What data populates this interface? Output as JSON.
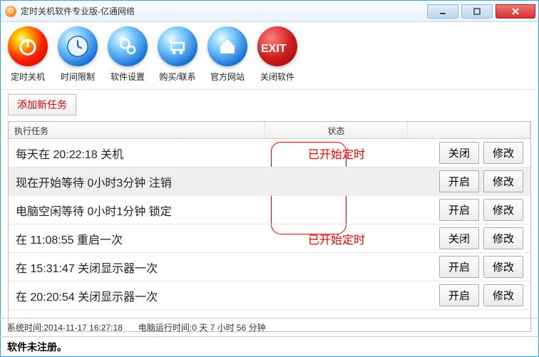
{
  "window": {
    "title": "定时关机软件专业版-亿通网络"
  },
  "toolbar": [
    {
      "id": "shutdown",
      "label": "定时关机",
      "color": "red",
      "glyph": "power"
    },
    {
      "id": "timelimit",
      "label": "时间限制",
      "color": "blue",
      "glyph": "clock"
    },
    {
      "id": "settings",
      "label": "软件设置",
      "color": "blue",
      "glyph": "gears"
    },
    {
      "id": "buy",
      "label": "购买/联系",
      "color": "blue",
      "glyph": "cart"
    },
    {
      "id": "website",
      "label": "官方网站",
      "color": "blue",
      "glyph": "home"
    },
    {
      "id": "exit",
      "label": "关闭软件",
      "color": "darkred",
      "glyph": "exit"
    }
  ],
  "addTaskLabel": "添加新任务",
  "columns": {
    "task": "执行任务",
    "status": "状态"
  },
  "btn": {
    "close": "关闭",
    "open": "开启",
    "edit": "修改"
  },
  "statusStarted": "已开始定时",
  "tasks": [
    {
      "text": "每天在 20:22:18 关机",
      "status": "started",
      "btn1": "close"
    },
    {
      "text": "现在开始等待 0小时3分钟 注销",
      "status": "",
      "btn1": "open",
      "selected": true
    },
    {
      "text": "电脑空闲等待 0小时1分钟 锁定",
      "status": "",
      "btn1": "open"
    },
    {
      "text": "在 11:08:55 重启一次",
      "status": "started",
      "btn1": "close"
    },
    {
      "text": "在 15:31:47 关闭显示器一次",
      "status": "",
      "btn1": "open"
    },
    {
      "text": "在 20:20:54 关闭显示器一次",
      "status": "",
      "btn1": "open"
    }
  ],
  "footer": {
    "systime_label": "系统时间:",
    "systime": "2014-11-17 16:27:18",
    "uptime_label": "电脑运行时间:",
    "uptime": "0 天 7 小时 56 分钟",
    "register": "软件未注册。"
  }
}
